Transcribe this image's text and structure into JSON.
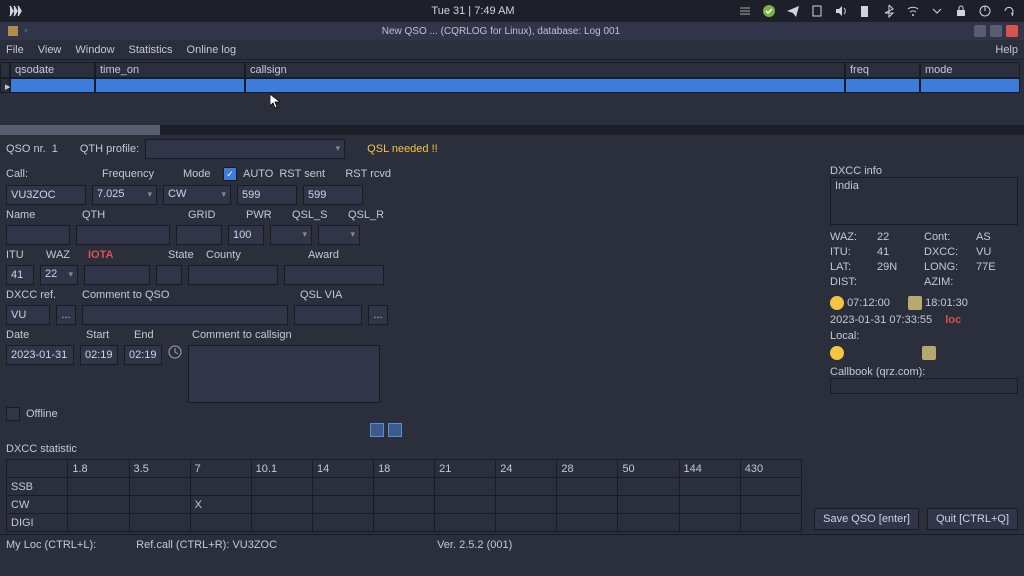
{
  "topbar": {
    "datetime": "Tue 31 | 7:49 AM"
  },
  "titlebar": {
    "title": "New QSO ... (CQRLOG for Linux), database: Log 001"
  },
  "menu": {
    "file": "File",
    "view": "View",
    "window": "Window",
    "statistics": "Statistics",
    "online": "Online log",
    "help": "Help"
  },
  "columns": {
    "qsodate": "qsodate",
    "time_on": "time_on",
    "callsign": "callsign",
    "freq": "freq",
    "mode": "mode"
  },
  "qso": {
    "nr_label": "QSO nr.",
    "nr": "1",
    "qth_profile_label": "QTH profile:",
    "qsl_needed": "QSL needed !!"
  },
  "labels": {
    "call": "Call:",
    "frequency": "Frequency",
    "mode": "Mode",
    "auto": "AUTO",
    "rst_sent": "RST sent",
    "rst_rcvd": "RST rcvd",
    "name": "Name",
    "qth": "QTH",
    "grid": "GRID",
    "pwr": "PWR",
    "qsl_s": "QSL_S",
    "qsl_r": "QSL_R",
    "itu": "ITU",
    "waz": "WAZ",
    "iota": "IOTA",
    "state": "State",
    "county": "County",
    "award": "Award",
    "dxcc_ref": "DXCC ref.",
    "comment_qso": "Comment to QSO",
    "qsl_via": "QSL VIA",
    "date": "Date",
    "start": "Start",
    "end": "End",
    "comment_call": "Comment to callsign",
    "offline": "Offline"
  },
  "values": {
    "call": "VU3ZOC",
    "frequency": "7.025",
    "mode": "CW",
    "rst_sent": "599",
    "rst_rcvd": "599",
    "pwr": "100",
    "itu": "41",
    "waz": "22",
    "dxcc_ref": "VU",
    "date": "2023-01-31",
    "start": "02:19",
    "end": "02:19"
  },
  "dxcc": {
    "title": "DXCC info",
    "country": "India",
    "waz_l": "WAZ:",
    "waz": "22",
    "cont_l": "Cont:",
    "cont": "AS",
    "itu_l": "ITU:",
    "itu": "41",
    "dxcc_l": "DXCC:",
    "dxcc": "VU",
    "lat_l": "LAT:",
    "lat": "29N",
    "long_l": "LONG:",
    "long": "77E",
    "dist_l": "DIST:",
    "azim_l": "AZIM:",
    "sunrise": "07:12:00",
    "sunset": "18:01:30",
    "utc": "2023-01-31  07:33:55",
    "loc_flag": "loc",
    "local_l": "Local:",
    "callbook": "Callbook (qrz.com):"
  },
  "stat": {
    "title": "DXCC statistic",
    "bands": [
      "1.8",
      "3.5",
      "7",
      "10.1",
      "14",
      "18",
      "21",
      "24",
      "28",
      "50",
      "144",
      "430"
    ],
    "rows": [
      "SSB",
      "CW",
      "DIGI"
    ],
    "cw_7": "X"
  },
  "buttons": {
    "save": "Save QSO [enter]",
    "quit": "Quit [CTRL+Q]"
  },
  "status": {
    "myloc": "My Loc (CTRL+L):",
    "refcall": "Ref.call (CTRL+R): VU3ZOC",
    "version": "Ver. 2.5.2 (001)"
  }
}
